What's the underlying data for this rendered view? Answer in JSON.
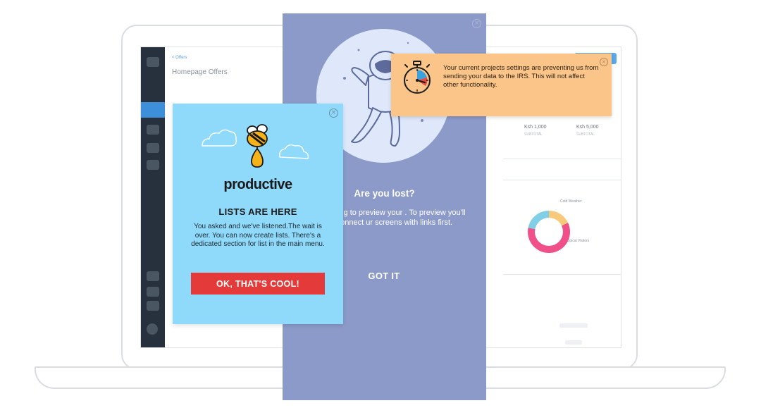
{
  "background_app": {
    "breadcrumb": "< Offers",
    "page_title": "Homepage Offers",
    "stats": [
      {
        "value": "Ksh 1,000",
        "label": "SUBTOTAL"
      },
      {
        "value": "Ksh 5,000",
        "label": "SUBTOTAL"
      }
    ],
    "chart_legend": [
      "Cold Weather",
      "Tropical Visitors"
    ]
  },
  "productive_card": {
    "brand": "productive",
    "heading": "LISTS ARE HERE",
    "body": "You asked and we've listened.The wait is over. You can now create lists. There's a dedicated section for list in the main menu.",
    "cta_label": "OK, THAT'S COOL!",
    "close_glyph": "×",
    "colors": {
      "background": "#8fd9fb",
      "cta": "#e53a3a"
    }
  },
  "lost_modal": {
    "heading": "Are you lost?",
    "body": "ke you're trying to preview your . To preview you'll need to connect ur screens with links first.",
    "cta_label": "GOT IT",
    "close_glyph": "×",
    "colors": {
      "background": "#8c9ac9",
      "circle": "#dfe8fb"
    }
  },
  "irs_notice": {
    "message": "Your current projects settings are preventing us from sending your data to the IRS. This will not affect other functionality.",
    "close_glyph": "×",
    "icon": "stopwatch-icon",
    "colors": {
      "background": "#fbc589"
    }
  }
}
